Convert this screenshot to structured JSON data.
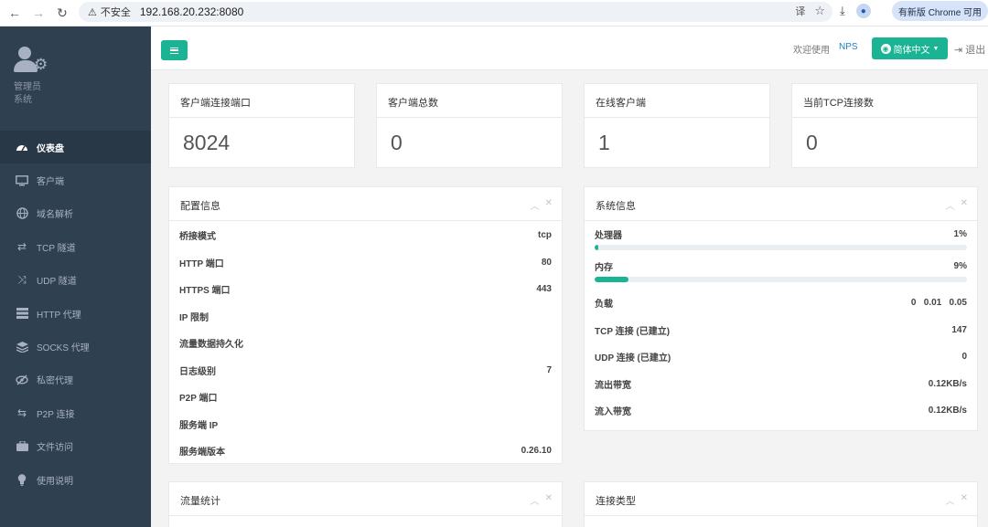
{
  "browser": {
    "insecure_label": "不安全",
    "url": "192.168.20.232:8080",
    "update_label": "有新版 Chrome 可用"
  },
  "sidebar": {
    "profile_name": "管理员",
    "profile_role": "系统",
    "items": [
      {
        "label": "仪表盘",
        "icon": "dashboard-icon",
        "active": true
      },
      {
        "label": "客户端",
        "icon": "monitor-icon"
      },
      {
        "label": "域名解析",
        "icon": "globe-icon"
      },
      {
        "label": "TCP 隧道",
        "icon": "retweet-icon"
      },
      {
        "label": "UDP 隧道",
        "icon": "random-icon"
      },
      {
        "label": "HTTP 代理",
        "icon": "server-icon"
      },
      {
        "label": "SOCKS 代理",
        "icon": "layers-icon"
      },
      {
        "label": "私密代理",
        "icon": "eye-slash-icon"
      },
      {
        "label": "P2P 连接",
        "icon": "exchange-icon"
      },
      {
        "label": "文件访问",
        "icon": "briefcase-icon"
      },
      {
        "label": "使用说明",
        "icon": "lightbulb-icon"
      }
    ]
  },
  "topbar": {
    "welcome": "欢迎使用",
    "brand": "NPS",
    "language": "简体中文",
    "logout": "退出"
  },
  "stats": [
    {
      "label": "客户端连接端口",
      "value": "8024"
    },
    {
      "label": "客户端总数",
      "value": "0"
    },
    {
      "label": "在线客户端",
      "value": "1"
    },
    {
      "label": "当前TCP连接数",
      "value": "0"
    }
  ],
  "config": {
    "title": "配置信息",
    "rows": [
      {
        "k": "桥接模式",
        "v": "tcp"
      },
      {
        "k": "HTTP 端口",
        "v": "80"
      },
      {
        "k": "HTTPS 端口",
        "v": "443"
      },
      {
        "k": "IP 限制",
        "v": ""
      },
      {
        "k": "流量数据持久化",
        "v": ""
      },
      {
        "k": "日志级别",
        "v": "7"
      },
      {
        "k": "P2P 端口",
        "v": ""
      },
      {
        "k": "服务端 IP",
        "v": ""
      },
      {
        "k": "服务端版本",
        "v": "0.26.10"
      }
    ]
  },
  "system": {
    "title": "系统信息",
    "cpu": {
      "k": "处理器",
      "v": "1%",
      "percent": 1
    },
    "mem": {
      "k": "内存",
      "v": "9%",
      "percent": 9
    },
    "rows": [
      {
        "k": "负载",
        "v": "0   0.01   0.05"
      },
      {
        "k": "TCP 连接 (已建立)",
        "v": "147"
      },
      {
        "k": "UDP 连接 (已建立)",
        "v": "0"
      },
      {
        "k": "流出带宽",
        "v": "0.12KB/s"
      },
      {
        "k": "流入带宽",
        "v": "0.12KB/s"
      }
    ]
  },
  "traffic": {
    "title": "流量统计"
  },
  "conn_types": {
    "title": "连接类型"
  },
  "colors": {
    "accent": "#1ab394",
    "sidebar": "#2f4050",
    "link": "#1c84c6"
  }
}
